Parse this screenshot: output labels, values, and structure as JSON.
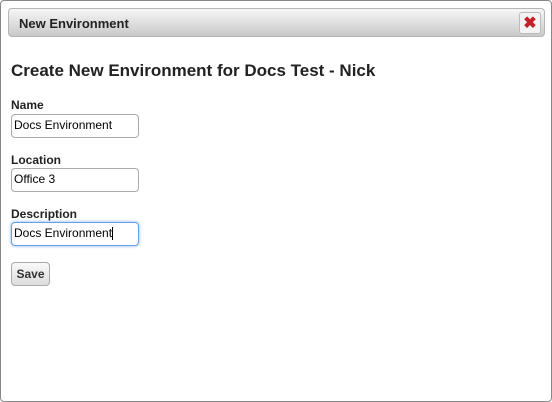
{
  "dialog": {
    "title": "New Environment",
    "heading": "Create New Environment for Docs Test - Nick",
    "close_icon": "close-x-icon"
  },
  "form": {
    "name_label": "Name",
    "name_value": "Docs Environment",
    "location_label": "Location",
    "location_value": "Office 3",
    "description_label": "Description",
    "description_value": "Docs Environment",
    "save_label": "Save"
  }
}
